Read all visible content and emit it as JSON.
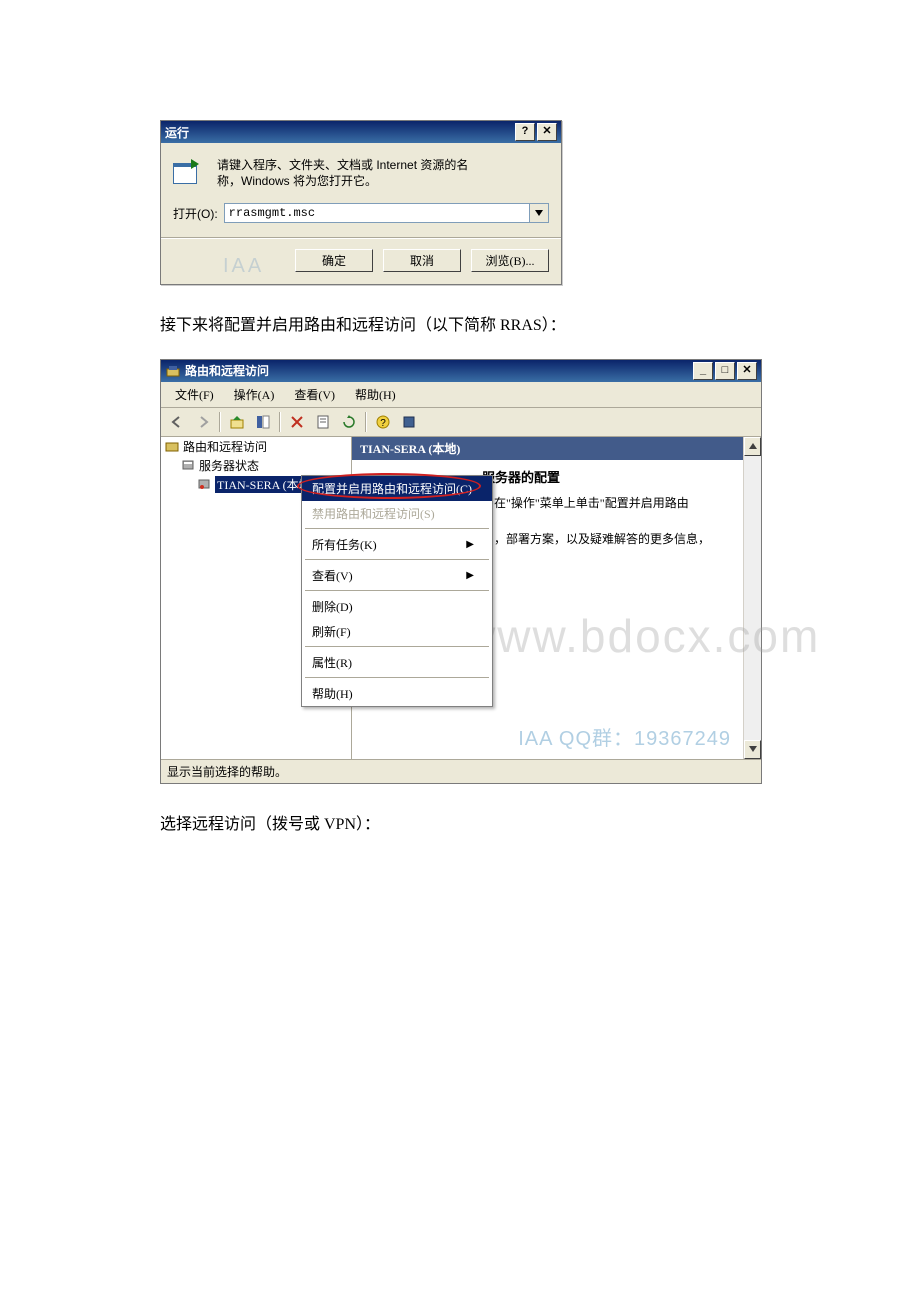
{
  "run": {
    "title": "运行",
    "desc_line1": "请键入程序、文件夹、文档或 Internet 资源的名",
    "desc_line2": "称，Windows 将为您打开它。",
    "open_label": "打开(O):",
    "value": "rrasmgmt.msc",
    "ok": "确定",
    "cancel": "取消",
    "browse": "浏览(B)..."
  },
  "caption1": "接下来将配置并启用路由和远程访问（以下简称 RRAS）：",
  "mmc": {
    "title": "路由和远程访问",
    "menus": {
      "file": "文件(F)",
      "action": "操作(A)",
      "view": "查看(V)",
      "help": "帮助(H)"
    },
    "tree": {
      "root": "路由和远程访问",
      "status": "服务器状态",
      "server": "TIAN-SERA (本地)"
    },
    "content": {
      "header": "TIAN-SERA (本地)",
      "heading": "服务器的配置",
      "line1_tail": "，在\"操作\"菜单上单击\"配置并启用路由",
      "line2_tail": "问，部署方案，以及疑难解答的更多信息，"
    },
    "ctx": {
      "configure": "配置并启用路由和远程访问(C)",
      "disable": "禁用路由和远程访问(S)",
      "all_tasks": "所有任务(K)",
      "view": "查看(V)",
      "delete": "删除(D)",
      "refresh": "刷新(F)",
      "properties": "属性(R)",
      "help": "帮助(H)"
    },
    "status": "显示当前选择的帮助。"
  },
  "watermarks": {
    "big": "www.bdocx.com",
    "footer_right": "IAA  QQ群：19367249",
    "run_overlay": "IAA"
  },
  "caption2": "选择远程访问（拨号或 VPN）："
}
